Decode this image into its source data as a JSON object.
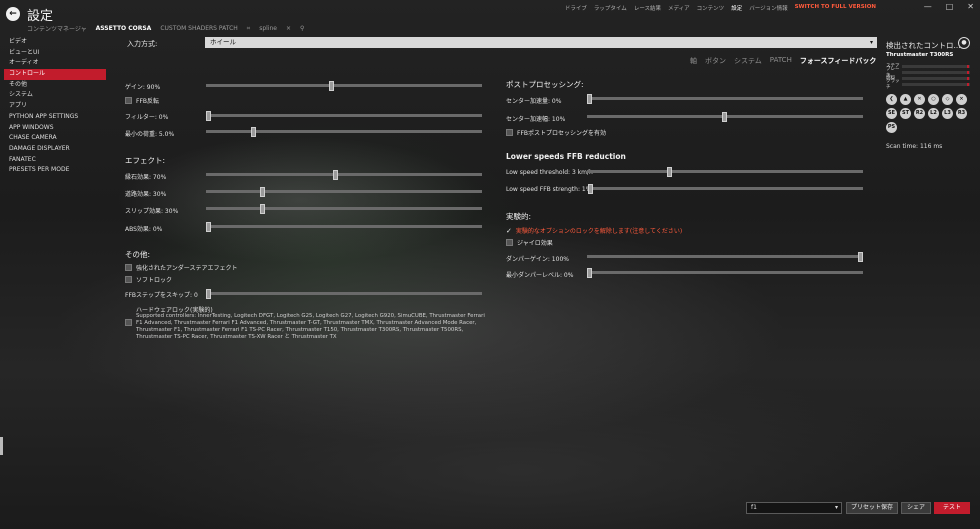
{
  "header": {
    "back_icon": "back-arrow-icon",
    "title": "設定",
    "subtabs": [
      "コンテンツマネージャ",
      "ASSETTO CORSA",
      "CUSTOM SHADERS PATCH",
      "spline"
    ],
    "subtabs_active": "ASSETTO CORSA",
    "close_tab": "×",
    "search_icon": "search-icon",
    "topnav": [
      "ドライブ",
      "ラップタイム",
      "レース結果",
      "メディア",
      "コンテンツ",
      "設定",
      "バージョン情報"
    ],
    "topnav_active": "設定",
    "full_version": "SWITCH TO FULL VERSION",
    "window_controls": [
      "—",
      "□",
      "✕"
    ]
  },
  "sidebar": {
    "items": [
      "ビデオ",
      "ビューとUI",
      "オーディオ",
      "コントロール",
      "その他",
      "システム",
      "アプリ",
      "PYTHON APP SETTINGS",
      "APP WINDOWS",
      "CHASE CAMERA",
      "DAMAGE DISPLAYER",
      "FANATEC",
      "PRESETS PER MODE"
    ],
    "active": "コントロール"
  },
  "input": {
    "label": "入力方式:",
    "value": "ホイール"
  },
  "ffb_tabs": [
    "軸",
    "ボタン",
    "システム",
    "PATCH",
    "フォースフィードバック"
  ],
  "ffb_tabs_active": "フォースフィードバック",
  "left": {
    "gain": {
      "label": "ゲイン: 90%",
      "value": 90
    },
    "ffb_invert": "FFB反転",
    "filter": {
      "label": "フィルター: 0%",
      "value": 0
    },
    "min_force": {
      "label": "最小の荷重: 5.0%",
      "value": 5
    },
    "effects_title": "エフェクト:",
    "kerb": {
      "label": "縁石効果: 70%",
      "value": 70
    },
    "road": {
      "label": "道路効果: 30%",
      "value": 30
    },
    "slip": {
      "label": "スリップ効果: 30%",
      "value": 30
    },
    "abs": {
      "label": "ABS効果: 0%",
      "value": 0
    },
    "other_title": "その他:",
    "enhanced_understeer": "強化されたアンダーステアエフェクト",
    "soft_lock": "ソフトロック",
    "skip_steps": {
      "label": "FFBステップをスキップ: 0",
      "value": 0
    },
    "hw_lock_title": "ハードウェアロック(実験的)",
    "hw_lock_desc": "Supported controllers: InnerTesting, Logitech DFGT, Logitech G25, Logitech G27, Logitech G920, SimuCUBE, Thrustmaster Ferrari F1 Advanced, Thrustmaster Ferrari F1 Advanced, Thrustmaster T-GT, Thrustmaster TMX, Thrustmaster Advanced Mode Racer, Thrustmaster F1, Thrustmaster Ferrari F1 TS-PC Racer, Thrustmaster T150, Thrustmaster T300RS, Thrustmaster T500RS, Thrustmaster TS-PC Racer, Thrustmaster TS-XW Racer と Thrustmaster TX"
  },
  "right": {
    "post_title": "ポストプロセッシング:",
    "center_boost_gain": {
      "label": "センター加速量: 0%",
      "value": 0
    },
    "center_boost_range": {
      "label": "センター加速幅: 10%",
      "value": 10
    },
    "ffb_post_enable": "FFBポストプロセッシングを有効",
    "lowspeed_title": "Lower speeds FFB reduction",
    "lowspeed_threshold": {
      "label": "Low speed threshold: 3 km/h",
      "value": 3
    },
    "lowspeed_strength": {
      "label": "Low speed FFB strength: 1%",
      "value": 1
    },
    "exp_title": "実験的:",
    "unlock_experimental": "実験的なオプションのロックを解除します(注意してください)",
    "gyro": "ジャイロ効果",
    "damper_gain": {
      "label": "ダンパーゲイン: 100%",
      "value": 100
    },
    "damper_min": {
      "label": "最小ダンパーレベル: 0%",
      "value": 0
    }
  },
  "controllers": {
    "title": "検出されたコントロ...",
    "device": "Thrustmaster T300RS",
    "axes": [
      "ステア",
      "ブレーキ",
      "燃料",
      "クラッチ"
    ],
    "buttons": [
      "❮",
      "▲",
      "✕",
      "○",
      "◇",
      "×",
      "SE",
      "ST",
      "R2",
      "L2",
      "L3",
      "R3",
      "PS"
    ],
    "scan_time": "Scan time: 116 ms"
  },
  "footer": {
    "preset_value": "f1",
    "save_preset": "プリセット保存",
    "share": "シェア",
    "test": "テスト"
  },
  "colors": {
    "accent": "#c21c2c",
    "warning": "#ff5a3c"
  }
}
